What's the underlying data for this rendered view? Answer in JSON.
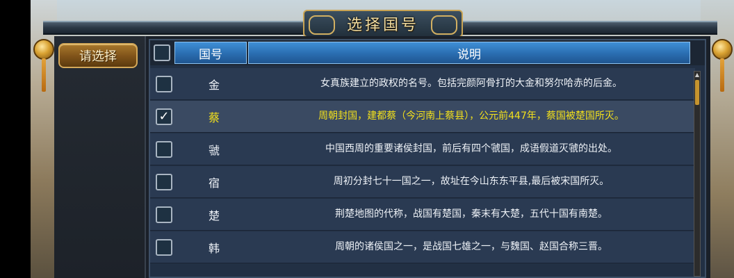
{
  "window": {
    "title": "选择国号"
  },
  "sidebar": {
    "select_button": "请选择"
  },
  "table": {
    "columns": [
      "国号",
      "说明"
    ],
    "rows": [
      {
        "name": "金",
        "desc": "女真族建立的政权的名号。包括完颜阿骨打的大金和努尔哈赤的后金。",
        "checked": false
      },
      {
        "name": "蔡",
        "desc": "周朝封国，建都蔡（今河南上蔡县），公元前447年，蔡国被楚国所灭。",
        "checked": true
      },
      {
        "name": "虢",
        "desc": "中国西周的重要诸侯封国，前后有四个虢国，成语假道灭虢的出处。",
        "checked": false
      },
      {
        "name": "宿",
        "desc": "周初分封七十一国之一，故址在今山东东平县,最后被宋国所灭。",
        "checked": false
      },
      {
        "name": "楚",
        "desc": "荆楚地图的代称，战国有楚国，秦末有大楚，五代十国有南楚。",
        "checked": false
      },
      {
        "name": "韩",
        "desc": "周朝的诸侯国之一，是战国七雄之一，与魏国、赵国合称三晋。",
        "checked": false
      }
    ],
    "check_mark": "✓",
    "colors": {
      "selected_text": "#f2e01c",
      "header_blue": "#2a6db0",
      "row_bg": "#2a3a52"
    }
  },
  "icons": {
    "scroll_up": "▲"
  }
}
